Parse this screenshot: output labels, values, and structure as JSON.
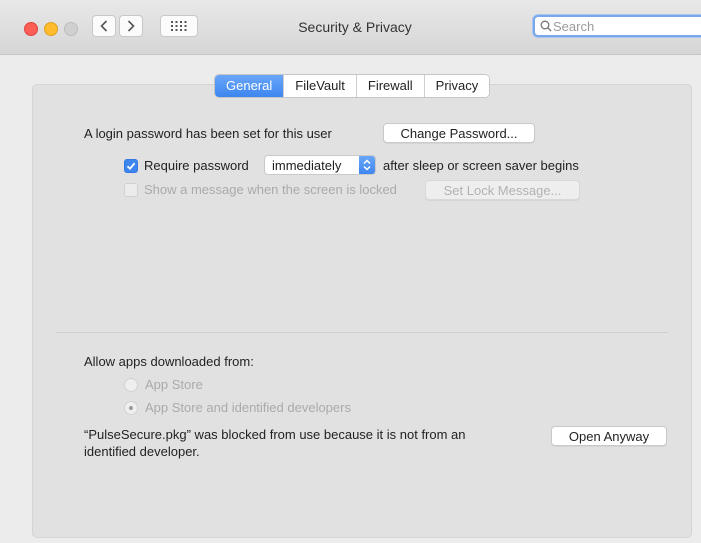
{
  "window": {
    "title": "Security & Privacy",
    "search_placeholder": "Search"
  },
  "tabs": [
    {
      "label": "General",
      "active": true
    },
    {
      "label": "FileVault",
      "active": false
    },
    {
      "label": "Firewall",
      "active": false
    },
    {
      "label": "Privacy",
      "active": false
    }
  ],
  "general": {
    "login_text": "A login password has been set for this user",
    "change_password_label": "Change Password...",
    "require_password_label": "Require password",
    "require_password_checked": true,
    "require_password_delay": "immediately",
    "after_sleep_text": "after sleep or screen saver begins",
    "show_message_label": "Show a message when the screen is locked",
    "show_message_checked": false,
    "set_lock_message_label": "Set Lock Message..."
  },
  "apps": {
    "heading": "Allow apps downloaded from:",
    "options": [
      {
        "label": "App Store",
        "selected": false
      },
      {
        "label": "App Store and identified developers",
        "selected": true
      }
    ],
    "blocked_line1": "“PulseSecure.pkg” was blocked from use because it is not from an",
    "blocked_line2": "identified developer.",
    "open_anyway_label": "Open Anyway"
  },
  "colors": {
    "accent": "#3d86f0",
    "close": "#fd5f57",
    "minimize": "#febc2e"
  }
}
